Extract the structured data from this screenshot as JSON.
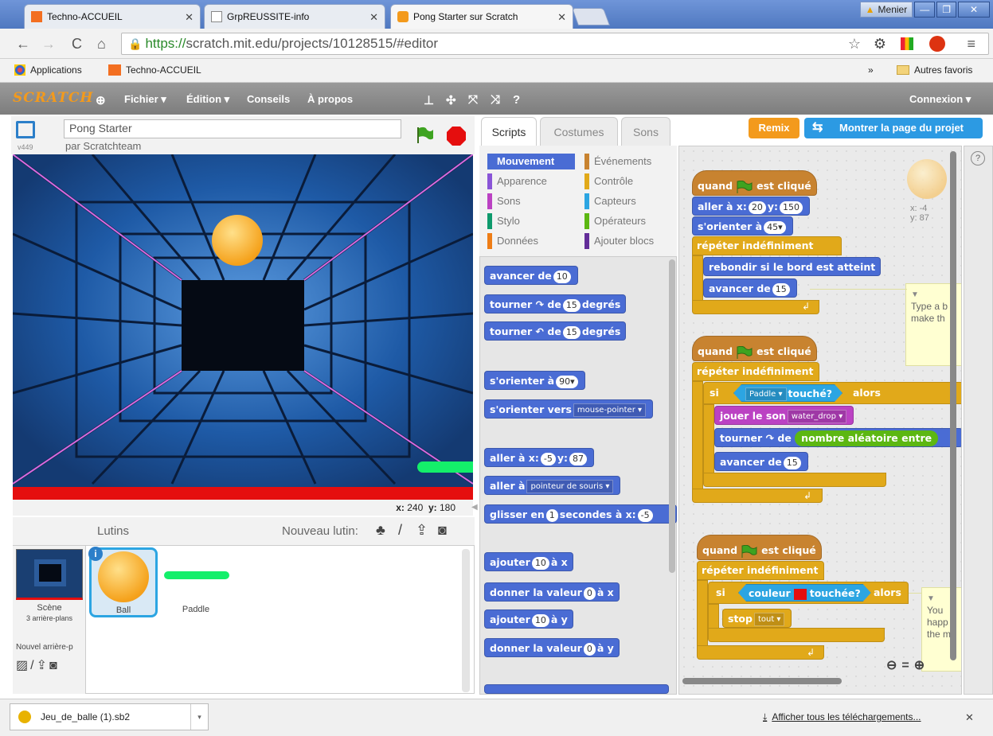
{
  "browser": {
    "tabs": [
      {
        "title": "Techno-ACCUEIL",
        "active": false
      },
      {
        "title": "GrpREUSSITE-info",
        "active": false
      },
      {
        "title": "Pong Starter sur Scratch",
        "active": true
      }
    ],
    "user": "Menier",
    "url_https": "https://",
    "url_rest": "scratch.mit.edu/projects/10128515/#editor",
    "bookmarks": {
      "apps": "Applications",
      "item1": "Techno-ACCUEIL",
      "more": "»",
      "other": "Autres favoris"
    }
  },
  "scratch_menu": {
    "logo": "SCRATCH",
    "items": [
      "Fichier ▾",
      "Édition ▾",
      "Conseils",
      "À propos"
    ],
    "login": "Connexion ▾"
  },
  "stage": {
    "project_title": "Pong Starter",
    "author": "par Scratchteam",
    "version": "v449",
    "coords": {
      "x_label": "x:",
      "x": "240",
      "y_label": "y:",
      "y": "180"
    }
  },
  "sprites": {
    "header": "Lutins",
    "new_sprite": "Nouveau lutin:",
    "scene_label": "Scène",
    "scene_sub": "3 arrière-plans",
    "new_backdrop": "Nouvel arrière-p",
    "items": [
      {
        "name": "Ball",
        "selected": true
      },
      {
        "name": "Paddle",
        "selected": false
      }
    ]
  },
  "editor_tabs": [
    "Scripts",
    "Costumes",
    "Sons"
  ],
  "top_buttons": {
    "remix": "Remix",
    "see_page": "Montrer la page du projet"
  },
  "categories": [
    {
      "label": "Mouvement",
      "color": "#4a6cd4",
      "active": true
    },
    {
      "label": "Événements",
      "color": "#c88330"
    },
    {
      "label": "Apparence",
      "color": "#8a55d7"
    },
    {
      "label": "Contrôle",
      "color": "#e1a91a"
    },
    {
      "label": "Sons",
      "color": "#bb42c3"
    },
    {
      "label": "Capteurs",
      "color": "#2ca5e2"
    },
    {
      "label": "Stylo",
      "color": "#0e9a6c"
    },
    {
      "label": "Opérateurs",
      "color": "#5cb712"
    },
    {
      "label": "Données",
      "color": "#ee7d16"
    },
    {
      "label": "Ajouter blocs",
      "color": "#632d99"
    }
  ],
  "palette": {
    "b1": "avancer de",
    "b1v": "10",
    "b2a": "tourner",
    "b2b": "de",
    "b2v": "15",
    "b2c": "degrés",
    "b3a": "tourner",
    "b3b": "de",
    "b3v": "15",
    "b3c": "degrés",
    "b4": "s'orienter à",
    "b4v": "90▾",
    "b5": "s'orienter vers",
    "b5v": "mouse-pointer ▾",
    "b6a": "aller à x:",
    "b6x": "-5",
    "b6b": "y:",
    "b6y": "87",
    "b7": "aller à",
    "b7v": "pointeur de souris ▾",
    "b8a": "glisser en",
    "b8v": "1",
    "b8b": "secondes à x:",
    "b8x": "-5",
    "b9a": "ajouter",
    "b9v": "10",
    "b9b": "à x",
    "b10a": "donner la valeur",
    "b10v": "0",
    "b10b": "à x",
    "b11a": "ajouter",
    "b11v": "10",
    "b11b": "à y",
    "b12a": "donner la valeur",
    "b12v": "0",
    "b12b": "à y"
  },
  "scripts": {
    "s1": {
      "hat_a": "quand",
      "hat_b": "est cliqué",
      "goto_a": "aller à x:",
      "goto_x": "20",
      "goto_b": "y:",
      "goto_y": "150",
      "point_a": "s'orienter à",
      "point_v": "45▾",
      "forever": "répéter indéfiniment",
      "bounce": "rebondir si le bord est atteint",
      "move_a": "avancer de",
      "move_v": "15"
    },
    "s2": {
      "hat_a": "quand",
      "hat_b": "est cliqué",
      "forever": "répéter indéfiniment",
      "if": "si",
      "touch_v": "Paddle ▾",
      "touch_b": "touché?",
      "then": "alors",
      "sound_a": "jouer le son",
      "sound_v": "water_drop ▾",
      "turn_a": "tourner",
      "turn_b": "de",
      "rand": "nombre aléatoire entre",
      "move_a": "avancer de",
      "move_v": "15"
    },
    "s3": {
      "hat_a": "quand",
      "hat_b": "est cliqué",
      "forever": "répéter indéfiniment",
      "if": "si",
      "color_a": "couleur",
      "color_b": "touchée?",
      "then": "alors",
      "stop_a": "stop",
      "stop_v": "tout ▾"
    },
    "comment1": "Type a b make th",
    "comment2": "You happ the m",
    "sprite_x": "x: -4",
    "sprite_y": "y: 87"
  },
  "download": {
    "file": "Jeu_de_balle (1).sb2",
    "show_all": "Afficher tous les téléchargements..."
  }
}
